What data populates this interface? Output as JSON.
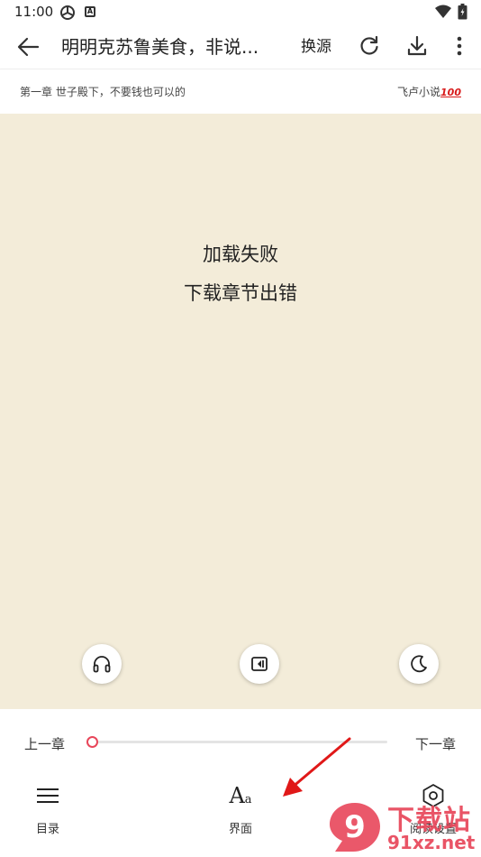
{
  "status_bar": {
    "time": "11:00",
    "icon_a": "A"
  },
  "toolbar": {
    "title": "明明克苏鲁美食，非说...",
    "change_source": "换源",
    "icons": [
      "back-arrow-icon",
      "refresh-icon",
      "download-icon",
      "more-vert-icon"
    ]
  },
  "chapter_bar": {
    "chapter_name": "第一章 世子殿下，不要钱也可以的",
    "source_name": "飞卢小说",
    "source_badge": "100"
  },
  "reader": {
    "error_line1": "加载失败",
    "error_line2": "下载章节出错",
    "background": "#f3ecd9"
  },
  "floating_buttons": [
    "headphones-icon",
    "auto-page-icon",
    "night-mode-icon"
  ],
  "bottom_panel": {
    "prev_chapter": "上一章",
    "next_chapter": "下一章",
    "progress": 0.0,
    "accent": "#e8465a",
    "menu": [
      {
        "label": "目录",
        "icon": "menu-list-icon"
      },
      {
        "label": "界面",
        "icon": "font-aa-icon",
        "glyph_big": "A",
        "glyph_small": "a"
      },
      {
        "label": "阅读设置",
        "icon": "settings-hexagon-icon"
      }
    ]
  },
  "watermark": {
    "logo_text": "9",
    "line1": "下载站",
    "line2": "91xz.net"
  }
}
